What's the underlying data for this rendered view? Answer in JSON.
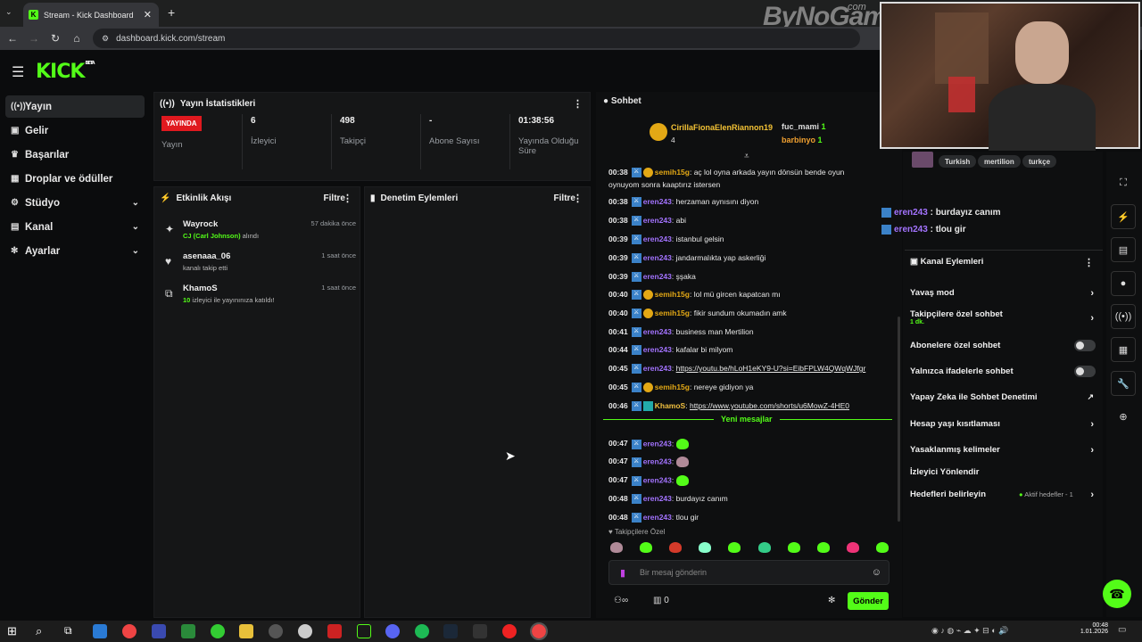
{
  "browser": {
    "tab_title": "Stream - Kick Dashboard",
    "url": "dashboard.kick.com/stream",
    "watermark": "ByNoGame",
    "watermark_sub": "com"
  },
  "app": {
    "logo": "KICK",
    "logo_badge": "BETA"
  },
  "sidebar": {
    "items": [
      {
        "label": "Yayın",
        "icon": "broadcast-icon"
      },
      {
        "label": "Gelir",
        "icon": "revenue-icon"
      },
      {
        "label": "Başarılar",
        "icon": "trophy-icon"
      },
      {
        "label": "Droplar ve ödüller",
        "icon": "gift-icon"
      },
      {
        "label": "Stüdyo",
        "icon": "studio-icon"
      },
      {
        "label": "Kanal",
        "icon": "channel-icon"
      },
      {
        "label": "Ayarlar",
        "icon": "gear-icon"
      }
    ]
  },
  "stats": {
    "title": "Yayın İstatistikleri",
    "live_badge": "YAYINDA",
    "cols": [
      {
        "value": "",
        "label": "Yayın"
      },
      {
        "value": "6",
        "label": "İzleyici"
      },
      {
        "value": "498",
        "label": "Takipçi"
      },
      {
        "value": "-",
        "label": "Abone Sayısı"
      },
      {
        "value": "01:38:56",
        "label": "Yayında Olduğu Süre"
      }
    ]
  },
  "activity": {
    "title": "Etkinlik Akışı",
    "filter": "Filtre",
    "events": [
      {
        "name": "Wayrock",
        "highlight": "CJ (Carl Johnson)",
        "sub": " alındı",
        "time": "57 dakika önce"
      },
      {
        "name": "asenaaa_06",
        "highlight": "",
        "sub": "kanalı takip etti",
        "time": "1 saat önce"
      },
      {
        "name": "KhamoS",
        "highlight": "10",
        "sub": " izleyici ile yayınınıza katıldı!",
        "time": "1 saat önce"
      }
    ]
  },
  "moderation": {
    "title": "Denetim Eylemleri",
    "filter": "Filtre"
  },
  "chat": {
    "title": "Sohbet",
    "top1_name": "CirillaFionaElenRiannon19",
    "top1_count": "4",
    "top2_name": "fuc_mami",
    "top2_count": "1",
    "top3_name": "barbinyo",
    "top3_count": "1",
    "messages": [
      {
        "time": "00:38",
        "user": "semih15g",
        "text": "aç lol oyna arkada yayın dönsün bende oyun",
        "cont": "oynuyom sonra kaaptırız istersen",
        "gold": true
      },
      {
        "time": "00:38",
        "user": "eren243",
        "text": "herzaman aynısını diyon"
      },
      {
        "time": "00:38",
        "user": "eren243",
        "text": "abi"
      },
      {
        "time": "00:39",
        "user": "eren243",
        "text": "istanbul gelsin"
      },
      {
        "time": "00:39",
        "user": "eren243",
        "text": "jandarmalıkta yap askerliği"
      },
      {
        "time": "00:39",
        "user": "eren243",
        "text": "şşaka"
      },
      {
        "time": "00:40",
        "user": "semih15g",
        "text": "lol mü gircen kapatcan mı",
        "gold": true
      },
      {
        "time": "00:40",
        "user": "semih15g",
        "text": "fikir sundum okumadın amk",
        "gold": true
      },
      {
        "time": "00:41",
        "user": "eren243",
        "text": "business man Mertilion"
      },
      {
        "time": "00:44",
        "user": "eren243",
        "text": "kafalar bi milyom"
      },
      {
        "time": "00:45",
        "user": "eren243",
        "link": "https://youtu.be/hLoH1eKY9-U?si=EibFPLW4QWqWJfgr"
      },
      {
        "time": "00:45",
        "user": "semih15g",
        "text": "nereye gidiyon ya",
        "gold": true
      },
      {
        "time": "00:46",
        "user": "KhamoS",
        "link": "https://www.youtube.com/shorts/u6MowZ-4HE0",
        "khamos": true
      }
    ],
    "new_label": "Yeni mesajlar",
    "new_messages": [
      {
        "time": "00:47",
        "user": "eren243",
        "emote": "green"
      },
      {
        "time": "00:47",
        "user": "eren243",
        "emote": "pink"
      },
      {
        "time": "00:47",
        "user": "eren243",
        "emote": "green"
      },
      {
        "time": "00:48",
        "user": "eren243",
        "text": "burdayız canım"
      },
      {
        "time": "00:48",
        "user": "eren243",
        "text": "tlou gir"
      }
    ],
    "followers_only": "Takipçilere Özel",
    "placeholder": "Bir mesaj gönderin",
    "points": "0",
    "send": "Gönder"
  },
  "overlay_chat": [
    {
      "user": "eren243",
      "text": "burdayız canım"
    },
    {
      "user": "eren243",
      "text": "tlou gir"
    }
  ],
  "tags": [
    "Turkish",
    "mertilion",
    "turkçe"
  ],
  "channel_actions": {
    "title": "Kanal Eylemleri",
    "items": [
      {
        "label": "Yavaş mod",
        "kind": "arrow"
      },
      {
        "label": "Takipçilere özel sohbet",
        "sub": "1 dk.",
        "kind": "arrow"
      },
      {
        "label": "Abonelere özel sohbet",
        "kind": "toggle"
      },
      {
        "label": "Yalnızca ifadelerle sohbet",
        "kind": "toggle"
      },
      {
        "label": "Yapay Zeka ile Sohbet Denetimi",
        "kind": "ext"
      },
      {
        "label": "Hesap yaşı kısıtlaması",
        "kind": "arrow"
      },
      {
        "label": "Yasaklanmış kelimeler",
        "kind": "arrow"
      },
      {
        "label": "İzleyici Yönlendir",
        "kind": "none"
      },
      {
        "label": "Hedefleri belirleyin",
        "extra": "Aktif hedefler - 1",
        "kind": "arrow"
      }
    ]
  },
  "taskbar": {
    "time": "00:48",
    "date": "1.01.2026"
  }
}
